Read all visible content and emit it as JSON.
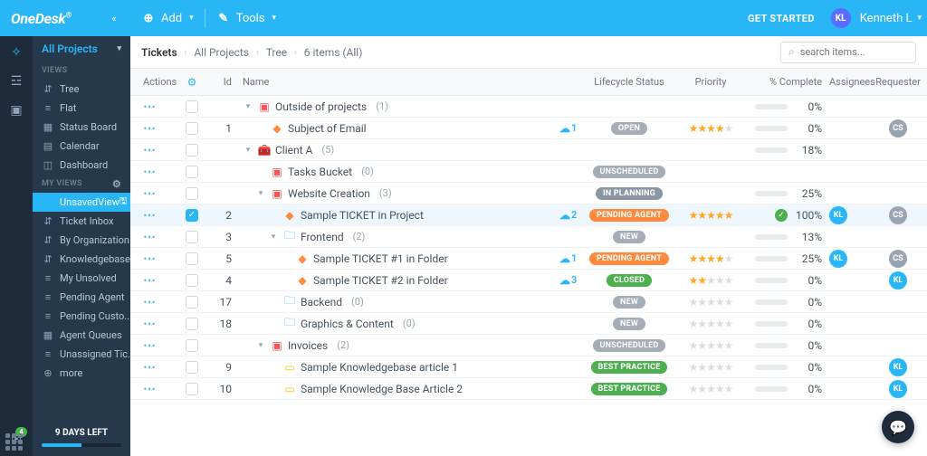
{
  "brand": "OneDesk",
  "topbar": {
    "add": "Add",
    "tools": "Tools",
    "getStarted": "GET STARTED",
    "userInitials": "KL",
    "userName": "Kenneth L"
  },
  "sidebar": {
    "allProjects": "All Projects",
    "viewsLabel": "VIEWS",
    "views": [
      {
        "icon": "⇵",
        "label": "Tree"
      },
      {
        "icon": "≡",
        "label": "Flat"
      },
      {
        "icon": "▦",
        "label": "Status Board"
      },
      {
        "icon": "▤",
        "label": "Calendar"
      },
      {
        "icon": "◫",
        "label": "Dashboard"
      }
    ],
    "myViewsLabel": "MY VIEWS",
    "myViews": [
      {
        "icon": "",
        "label": "UnsavedView",
        "active": true,
        "hasSave": true
      },
      {
        "icon": "⇵",
        "label": "Ticket Inbox"
      },
      {
        "icon": "⇵",
        "label": "By Organization"
      },
      {
        "icon": "⇵",
        "label": "Knowledgebase"
      },
      {
        "icon": "≡",
        "label": "My Unsolved"
      },
      {
        "icon": "≡",
        "label": "Pending Agent"
      },
      {
        "icon": "≡",
        "label": "Pending Custo..."
      },
      {
        "icon": "▦",
        "label": "Agent Queues"
      },
      {
        "icon": "≡",
        "label": "Unassigned Tic..."
      },
      {
        "icon": "⊕",
        "label": "more"
      }
    ],
    "trial": {
      "label": "9 DAYS LEFT",
      "pct": 50
    }
  },
  "railBadge": "4",
  "breadcrumbs": [
    "Tickets",
    "All Projects",
    "Tree",
    "6 items (All)"
  ],
  "searchPlaceholder": "search items...",
  "columns": {
    "actions": "Actions",
    "id": "Id",
    "name": "Name",
    "status": "Lifecycle Status",
    "priority": "Priority",
    "pct": "% Complete",
    "assignees": "Assignees",
    "requester": "Requester"
  },
  "rows": [
    {
      "indent": 0,
      "toggle": "▾",
      "iconClass": "ic-project",
      "icon": "▣",
      "name": "Outside of projects",
      "count": "(1)",
      "pct": 0
    },
    {
      "indent": 1,
      "id": "1",
      "iconClass": "ic-ticket",
      "icon": "◆",
      "name": "Subject of Email",
      "bubble": "1",
      "status": "OPEN",
      "statusClass": "open",
      "stars": 4,
      "pct": 0,
      "requester": "CS"
    },
    {
      "indent": 0,
      "toggle": "▾",
      "iconClass": "ic-portfolio",
      "icon": "🧰",
      "name": "Client A",
      "count": "(5)",
      "pct": 18,
      "pbar": 18
    },
    {
      "indent": 1,
      "iconClass": "ic-tasks",
      "icon": "▣",
      "name": "Tasks Bucket",
      "count": "(0)",
      "status": "UNSCHEDULED",
      "statusClass": "unscheduled"
    },
    {
      "indent": 1,
      "toggle": "▾",
      "iconClass": "ic-project",
      "icon": "▣",
      "name": "Website Creation",
      "count": "(3)",
      "status": "IN PLANNING",
      "statusClass": "inplanning",
      "pct": 25,
      "pbar": 25
    },
    {
      "indent": 2,
      "id": "2",
      "selected": true,
      "iconClass": "ic-ticket",
      "icon": "◆",
      "name": "Sample TICKET in Project",
      "bubble": "2",
      "status": "PENDING AGENT",
      "statusClass": "pending",
      "stars": 5,
      "pct": 100,
      "pcheck": true,
      "assignee": "KL",
      "requester": "CS"
    },
    {
      "indent": 2,
      "toggle": "▾",
      "id": "3",
      "iconClass": "ic-folder",
      "icon": "🗀",
      "name": "Frontend",
      "count": "(2)",
      "status": "NEW",
      "statusClass": "new",
      "pct": 13,
      "pbar": 13
    },
    {
      "indent": 3,
      "id": "5",
      "iconClass": "ic-ticket",
      "icon": "◆",
      "name": "Sample TICKET #1 in Folder",
      "bubble": "1",
      "status": "PENDING AGENT",
      "statusClass": "pending",
      "stars": 4,
      "pct": 25,
      "pbar": 25,
      "assignee": "KL",
      "requester": "CS"
    },
    {
      "indent": 3,
      "id": "4",
      "iconClass": "ic-ticket",
      "icon": "◆",
      "name": "Sample TICKET #2 in Folder",
      "bubble": "3",
      "status": "CLOSED",
      "statusClass": "closed",
      "stars": 2,
      "pct": 0,
      "requester": "KL",
      "requesterClass": "kl"
    },
    {
      "indent": 2,
      "id": "17",
      "iconClass": "ic-folder",
      "icon": "🗀",
      "name": "Backend",
      "count": "(0)",
      "status": "NEW",
      "statusClass": "new",
      "stars": 0,
      "pct": 0
    },
    {
      "indent": 2,
      "id": "18",
      "iconClass": "ic-folder",
      "icon": "🗀",
      "name": "Graphics & Content",
      "count": "(0)",
      "status": "NEW",
      "statusClass": "new",
      "stars": 0,
      "pct": 0
    },
    {
      "indent": 1,
      "toggle": "▾",
      "iconClass": "ic-project",
      "icon": "▣",
      "name": "Invoices",
      "count": "(2)",
      "status": "UNSCHEDULED",
      "statusClass": "unscheduled",
      "stars": 0,
      "pct": 0
    },
    {
      "indent": 2,
      "id": "9",
      "iconClass": "ic-article",
      "icon": "▭",
      "name": "Sample Knowledgebase article 1",
      "status": "BEST PRACTICE",
      "statusClass": "best",
      "stars": 0,
      "pct": 0,
      "requester": "KL",
      "requesterClass": "kl"
    },
    {
      "indent": 2,
      "id": "10",
      "iconClass": "ic-article",
      "icon": "▭",
      "name": "Sample Knowledge Base Article 2",
      "status": "BEST PRACTICE",
      "statusClass": "best",
      "stars": 0,
      "pct": 0,
      "requester": "KL",
      "requesterClass": "kl"
    }
  ]
}
